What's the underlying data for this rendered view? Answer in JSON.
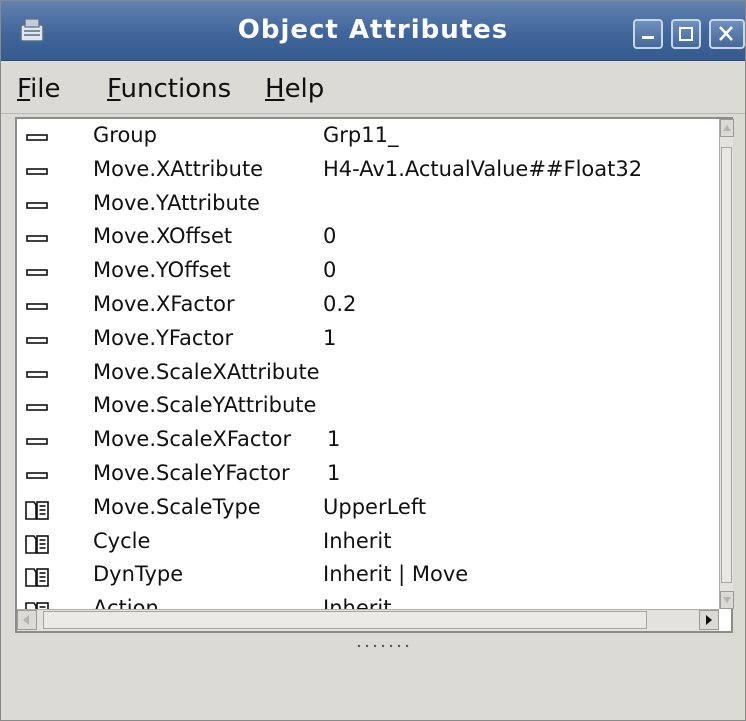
{
  "window": {
    "title": "Object Attributes",
    "icon": "app-icon",
    "controls": [
      "minimize-icon",
      "maximize-icon",
      "close-icon"
    ]
  },
  "menu": {
    "items": [
      {
        "label_first": "F",
        "label_rest": "ile"
      },
      {
        "label_first": "F",
        "label_rest": "unctions"
      },
      {
        "label_first": "H",
        "label_rest": "elp"
      }
    ]
  },
  "attributes": [
    {
      "icon": "attribute-icon",
      "name": "Group",
      "value": "Grp11_"
    },
    {
      "icon": "attribute-icon",
      "name": "Move.XAttribute",
      "value": "H4-Av1.ActualValue##Float32"
    },
    {
      "icon": "attribute-icon",
      "name": "Move.YAttribute",
      "value": ""
    },
    {
      "icon": "attribute-icon",
      "name": "Move.XOffset",
      "value": "0"
    },
    {
      "icon": "attribute-icon",
      "name": "Move.YOffset",
      "value": "0"
    },
    {
      "icon": "attribute-icon",
      "name": "Move.XFactor",
      "value": "0.2"
    },
    {
      "icon": "attribute-icon",
      "name": "Move.YFactor",
      "value": "1"
    },
    {
      "icon": "attribute-icon",
      "name": "Move.ScaleXAttribute",
      "value": ""
    },
    {
      "icon": "attribute-icon",
      "name": "Move.ScaleYAttribute",
      "value": ""
    },
    {
      "icon": "attribute-icon",
      "name": "Move.ScaleXFactor",
      "value": "1"
    },
    {
      "icon": "attribute-icon",
      "name": "Move.ScaleYFactor",
      "value": "1"
    },
    {
      "icon": "enum-icon",
      "name": "Move.ScaleType",
      "value": "UpperLeft"
    },
    {
      "icon": "enum-icon",
      "name": "Cycle",
      "value": "Inherit"
    },
    {
      "icon": "enum-icon",
      "name": "DynType",
      "value": "Inherit | Move"
    },
    {
      "icon": "enum-icon",
      "name": "Action",
      "value": "Inherit"
    }
  ],
  "colors": {
    "titlebar": "#41669a",
    "background": "#dcdad5",
    "list_background": "#ffffff"
  }
}
